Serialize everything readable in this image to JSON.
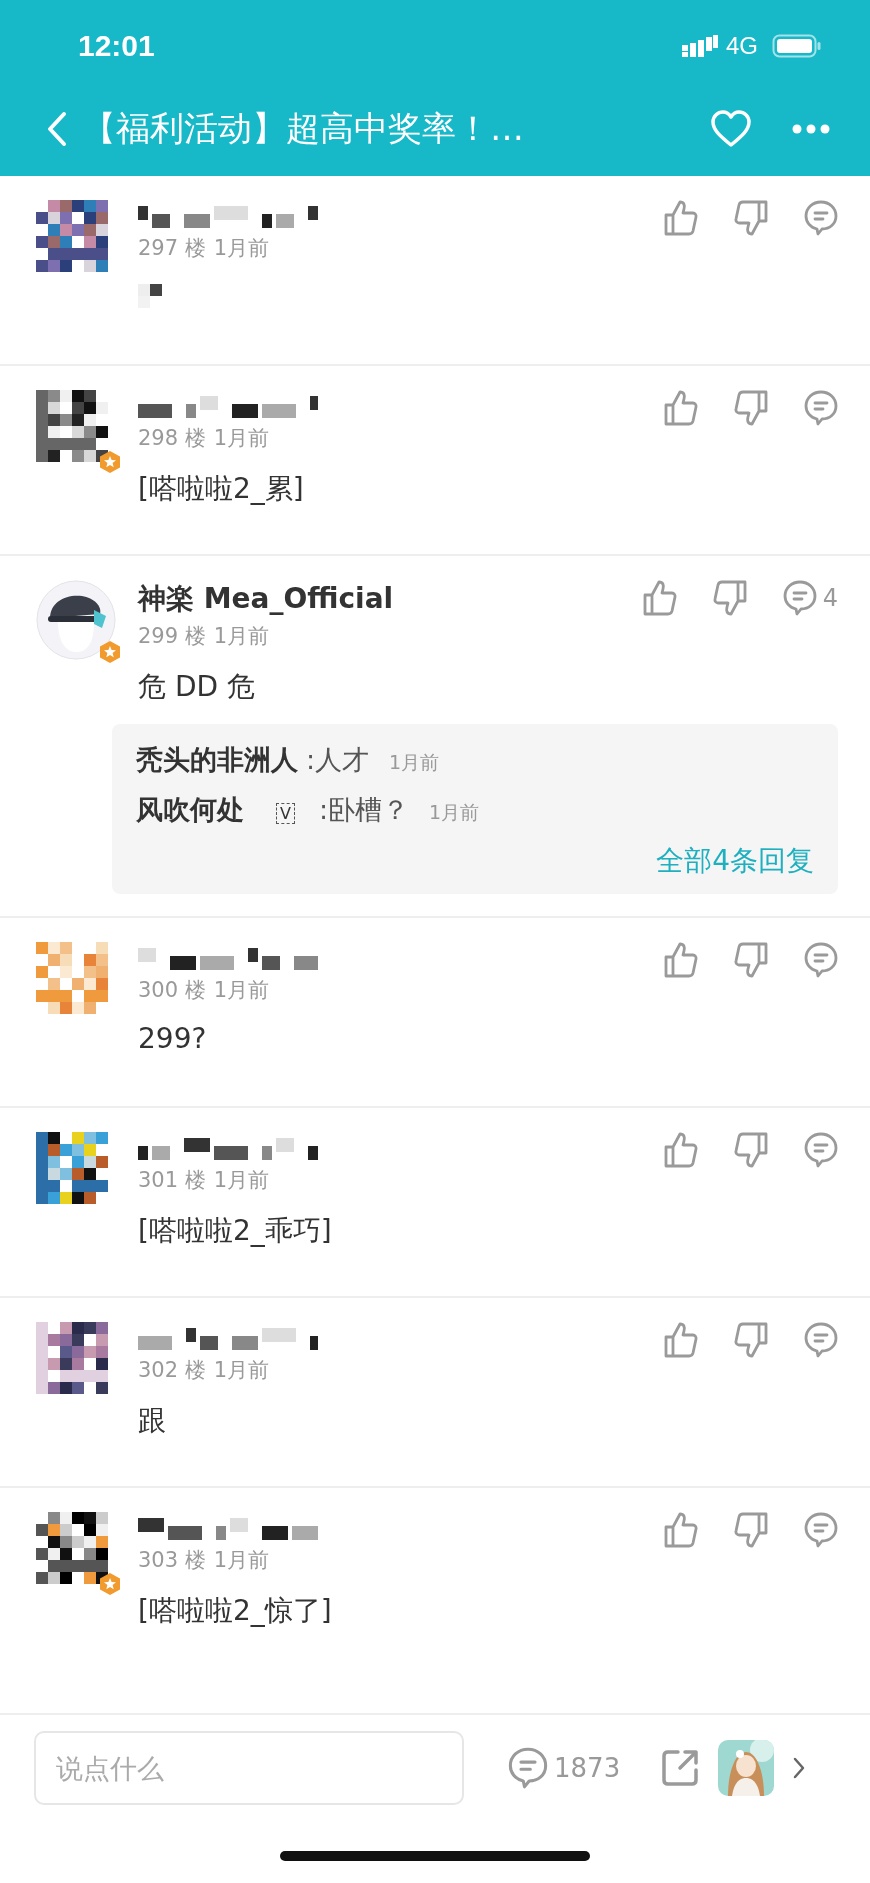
{
  "status_bar": {
    "time": "12:01",
    "network": "4G"
  },
  "header": {
    "title": "【福利活动】超高中奖率！…"
  },
  "comments": [
    {
      "name_hidden": true,
      "verified": false,
      "floor": "297 楼",
      "time": "1月前",
      "content_hidden": true
    },
    {
      "name_hidden": true,
      "verified": true,
      "floor": "298 楼",
      "time": "1月前",
      "content": "[嗒啦啦2_累]"
    },
    {
      "name_hidden": false,
      "name": "神楽 Mea_Official",
      "verified": true,
      "floor": "299 楼",
      "time": "1月前",
      "content": "危 DD 危",
      "reply_count": "4",
      "replies": [
        {
          "user": "秃头的非洲人",
          "text": ":人才",
          "time": "1月前"
        },
        {
          "user": "风吹何处",
          "badge": "V",
          "text": ":卧槽？",
          "time": "1月前"
        }
      ],
      "more": "全部4条回复"
    },
    {
      "name_hidden": true,
      "verified": false,
      "floor": "300 楼",
      "time": "1月前",
      "content": "299?"
    },
    {
      "name_hidden": true,
      "verified": false,
      "floor": "301 楼",
      "time": "1月前",
      "content": "[嗒啦啦2_乖巧]"
    },
    {
      "name_hidden": true,
      "verified": false,
      "floor": "302 楼",
      "time": "1月前",
      "content": "跟"
    },
    {
      "name_hidden": true,
      "verified": true,
      "floor": "303 楼",
      "time": "1月前",
      "content": "[嗒啦啦2_惊了]"
    }
  ],
  "bottom_bar": {
    "placeholder": "说点什么",
    "comment_count": "1873"
  }
}
